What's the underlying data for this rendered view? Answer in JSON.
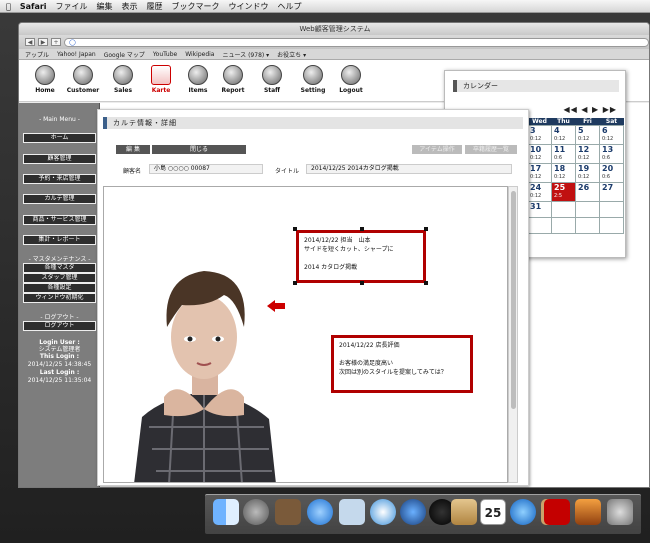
{
  "system_menu": {
    "apple": "",
    "app": "Safari",
    "items": [
      "ファイル",
      "編集",
      "表示",
      "履歴",
      "ブックマーク",
      "ウインドウ",
      "ヘルプ"
    ]
  },
  "window": {
    "title": "Web顧客管理システム",
    "nav_back": "◀",
    "nav_forward": "▶",
    "add_tab": "+"
  },
  "bookmarks": {
    "items": [
      "アップル",
      "Yahoo! Japan",
      "Google マップ",
      "YouTube",
      "Wikipedia",
      "ニュース (978) ▾",
      "お役立ち ▾"
    ]
  },
  "app_nav": {
    "items": [
      {
        "label": "Home",
        "icon": "home-icon"
      },
      {
        "label": "Customer",
        "icon": "customer-icon"
      },
      {
        "label": "Sales",
        "icon": "folder-icon"
      },
      {
        "label": "Karte",
        "icon": "document-icon",
        "active": true
      },
      {
        "label": "Items",
        "icon": "items-icon"
      },
      {
        "label": "Report",
        "icon": "chart-icon"
      },
      {
        "label": "Staff",
        "icon": "staff-icon"
      },
      {
        "label": "Setting",
        "icon": "settings-icon"
      },
      {
        "label": "Logout",
        "icon": "logout-icon"
      }
    ]
  },
  "sidebar": {
    "main_menu_header": "- Main Menu -",
    "main_buttons": [
      "ホーム",
      "顧客管理",
      "予約・来店管理",
      "カルテ管理",
      "商品・サービス管理",
      "集計・レポート"
    ],
    "master_header": "- マスタメンテナンス -",
    "master_buttons": [
      "各種マスタ",
      "スタッフ管理",
      "各種設定",
      "ウィンドウ初期化"
    ],
    "logout_header": "- ログアウト -",
    "logout_button": "ログアウト",
    "login_user_label": "Login User :",
    "login_user_value": "システム管理者",
    "this_login_label": "This Login :",
    "this_login_value": "2014/12/25 14:38:45",
    "last_login_label": "Last Login :",
    "last_login_value": "2014/12/25 11:35:04"
  },
  "calendar": {
    "title": "カレンダー",
    "nav": "◀◀ ◀ ▶ ▶▶",
    "headers": [
      "Wed",
      "Thu",
      "Fri",
      "Sat"
    ],
    "rows": [
      [
        {
          "d": "3",
          "s": "0:12"
        },
        {
          "d": "4",
          "s": "0:12"
        },
        {
          "d": "5",
          "s": "0:12"
        },
        {
          "d": "6",
          "s": "0:12"
        }
      ],
      [
        {
          "d": "10",
          "s": "0:12"
        },
        {
          "d": "11",
          "s": "0:6"
        },
        {
          "d": "12",
          "s": "0:12"
        },
        {
          "d": "13",
          "s": "0:6"
        }
      ],
      [
        {
          "d": "17",
          "s": "0:12"
        },
        {
          "d": "18",
          "s": "0:12"
        },
        {
          "d": "19",
          "s": "0:12"
        },
        {
          "d": "20",
          "s": "0:6"
        }
      ],
      [
        {
          "d": "24",
          "s": "0:12"
        },
        {
          "d": "25",
          "s": "2:5",
          "today": true
        },
        {
          "d": "26",
          "s": ""
        },
        {
          "d": "27",
          "s": ""
        }
      ],
      [
        {
          "d": "31",
          "s": ""
        },
        {
          "d": "",
          "s": ""
        },
        {
          "d": "",
          "s": ""
        },
        {
          "d": "",
          "s": ""
        }
      ],
      [
        {
          "d": "",
          "s": ""
        },
        {
          "d": "",
          "s": ""
        },
        {
          "d": "",
          "s": ""
        },
        {
          "d": "",
          "s": ""
        }
      ]
    ]
  },
  "karte": {
    "title": "カルテ情報・詳細",
    "edit_button": "編 集",
    "close_button": "閉じる",
    "item_action_button": "アイテム操作",
    "history_button": "卒籍履歴一覧",
    "customer_label": "顧客名",
    "customer_value": "小島 ○○○○ 00087",
    "title_label": "タイトル",
    "title_value": "2014/12/25 2014カタログ掲載",
    "note1": "2014/12/22 担当　山本\nサイドを短くカット、シャープに\n\n2014 カタログ掲載",
    "note2": "2014/12/22 店長評価\n\nお客様の満足度高い\n次回は別のスタイルを提案してみては？",
    "arrow_color": "#cc0000",
    "note_border_color": "#b00000"
  },
  "dock": {
    "items": [
      "finder-icon",
      "launchpad-icon",
      "photo-icon",
      "app-store-icon",
      "mail-icon",
      "safari-icon",
      "quicktime-icon",
      "itunes-icon",
      "contacts-icon",
      "calendar-icon",
      "music-icon",
      "book-icon",
      "photo-booth-icon",
      "iphoto-icon",
      "system-prefs-icon"
    ],
    "calendar_day": "25"
  }
}
